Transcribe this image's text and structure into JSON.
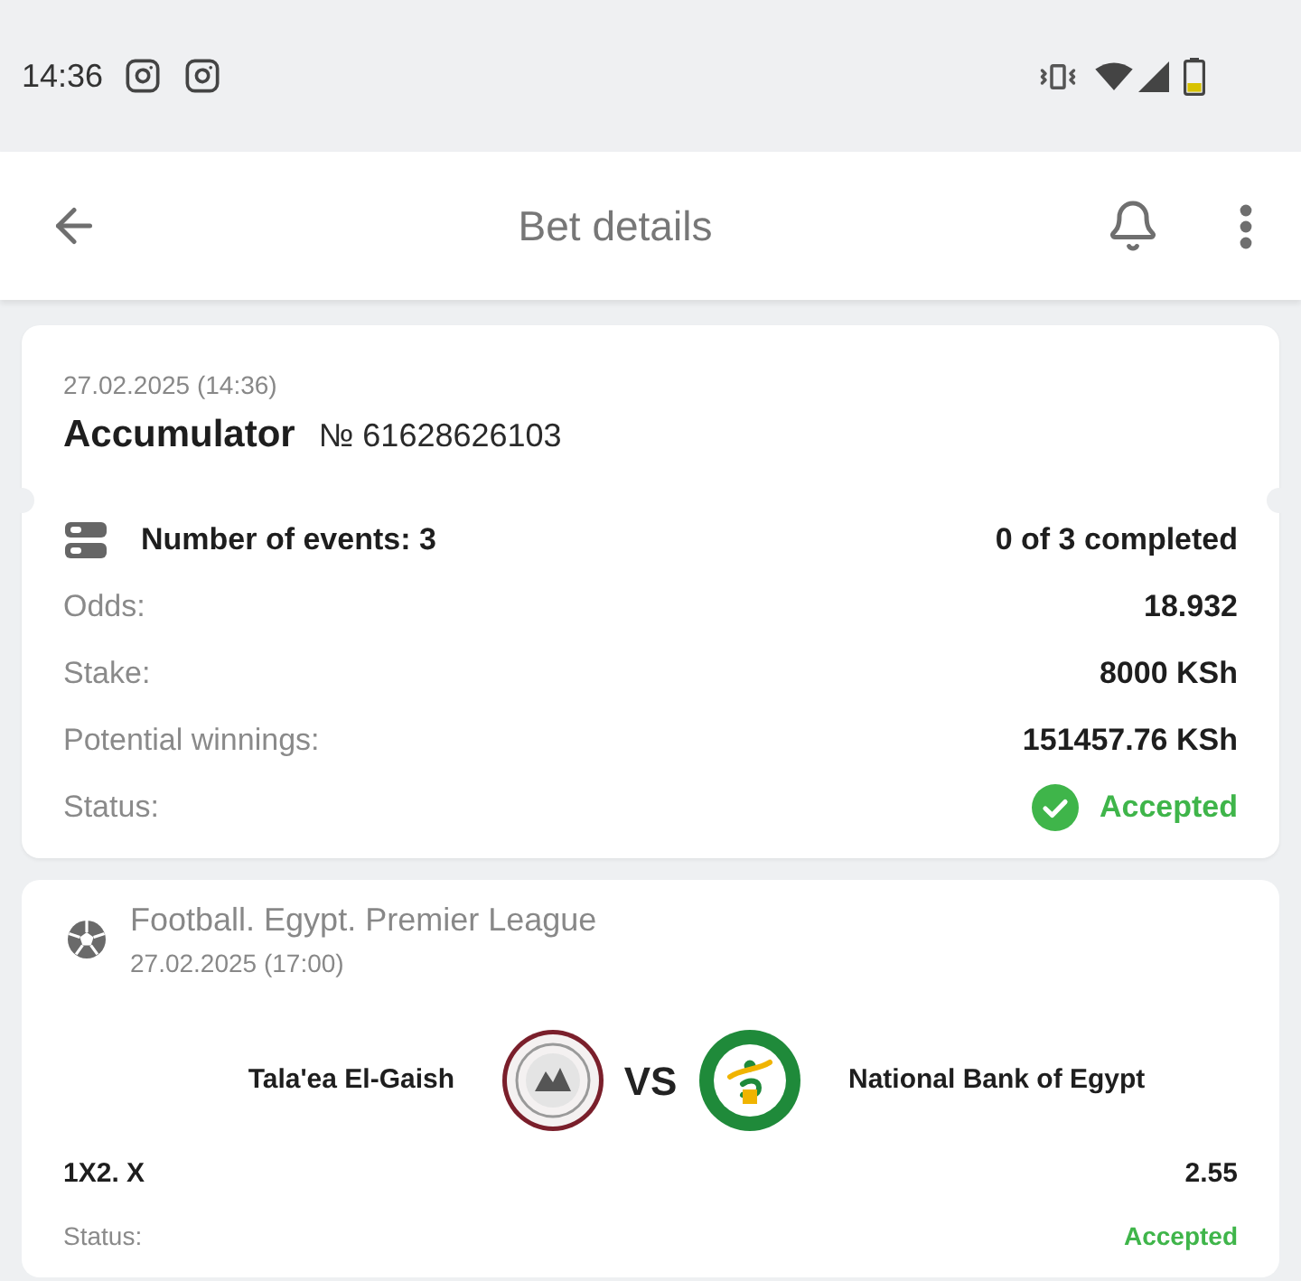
{
  "status_bar": {
    "time": "14:36"
  },
  "app_bar": {
    "title": "Bet details"
  },
  "bet": {
    "date": "27.02.2025 (14:36)",
    "type": "Accumulator",
    "number": "№ 61628626103",
    "events_label": "Number of events: 3",
    "completed": "0 of 3 completed",
    "rows": [
      {
        "label": "Odds:",
        "value": "18.932"
      },
      {
        "label": "Stake:",
        "value": "8000 KSh"
      },
      {
        "label": "Potential winnings:",
        "value": "151457.76 KSh"
      }
    ],
    "status": {
      "label": "Status:",
      "value": "Accepted",
      "kind": "accepted"
    }
  },
  "events": [
    {
      "sport": "Football. Egypt. Premier League",
      "date": "27.02.2025 (17:00)",
      "home": "Tala'ea El-Gaish",
      "vs": "VS",
      "away": "National Bank of Egypt",
      "market": "1X2. X",
      "odds": "2.55",
      "status": {
        "label": "Status:",
        "value": "Accepted",
        "kind": "accepted"
      }
    }
  ]
}
